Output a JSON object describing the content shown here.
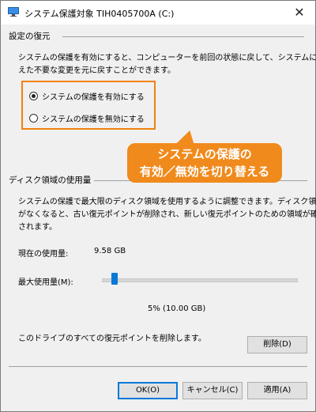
{
  "window": {
    "title": "システム保護対象 TIH0405700A (C:)",
    "close_glyph": "✕"
  },
  "restore_group": {
    "label": "設定の復元",
    "description_line1": "システムの保護を有効にすると、コンピューターを前回の状態に戻して、システムに加",
    "description_line2": "えた不要な変更を元に戻すことができます。",
    "options": [
      {
        "label": "システムの保護を有効にする",
        "checked": true
      },
      {
        "label": "システムの保護を無効にする",
        "checked": false
      }
    ]
  },
  "callout": {
    "line1": "システムの保護の",
    "line2": "有効／無効を切り替える",
    "color": "#f08a1c"
  },
  "disk_group": {
    "label": "ディスク領域の使用量",
    "description_line1": "システムの保護で最大限のディスク領域を使用するように調整できます。ディスク領域",
    "description_line2": "がなくなると、古い復元ポイントが削除され、新しい復元ポイントのための領域が確保",
    "description_line3": "されます。",
    "current_usage_label": "現在の使用量:",
    "current_usage_value": "9.58 GB",
    "max_usage_label": "最大使用量(M):",
    "max_usage_percent": 5,
    "max_usage_text": "5% (10.00 GB)",
    "delete_text": "このドライブのすべての復元ポイントを削除します。",
    "delete_button": "削除(D)"
  },
  "footer": {
    "ok": "OK(O)",
    "cancel": "キャンセル(C)",
    "apply": "適用(A)"
  },
  "colors": {
    "accent": "#0a78d7",
    "highlight": "#f0820f"
  }
}
